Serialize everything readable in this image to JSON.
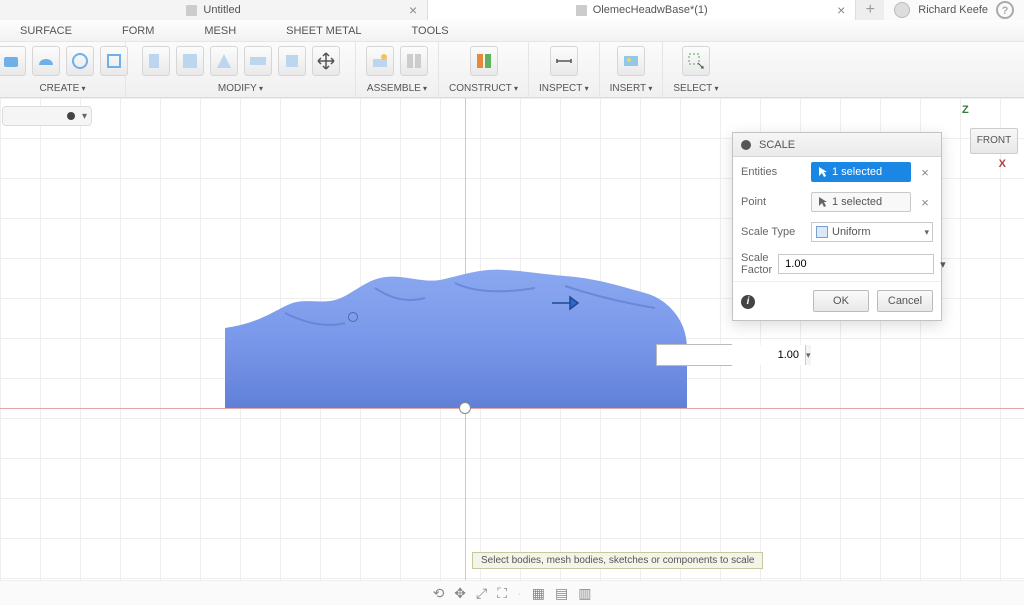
{
  "tabs": {
    "inactive": "Untitled",
    "active": "OlemecHeadwBase*(1)",
    "user": "Richard Keefe"
  },
  "menu": {
    "surface": "SURFACE",
    "form": "FORM",
    "mesh": "MESH",
    "sheetmetal": "SHEET METAL",
    "tools": "TOOLS"
  },
  "groups": {
    "create": "CREATE",
    "modify": "MODIFY",
    "assemble": "ASSEMBLE",
    "construct": "CONSTRUCT",
    "inspect": "INSPECT",
    "insert": "INSERT",
    "select": "SELECT"
  },
  "axis": {
    "z": "Z",
    "x": "X",
    "front": "FRONT"
  },
  "dialog": {
    "title": "SCALE",
    "entities_label": "Entities",
    "entities_value": "1 selected",
    "point_label": "Point",
    "point_value": "1 selected",
    "scaletype_label": "Scale Type",
    "scaletype_value": "Uniform",
    "scalefactor_label": "Scale Factor",
    "scalefactor_value": "1.00",
    "ok": "OK",
    "cancel": "Cancel"
  },
  "floatinput": "1.00",
  "hint": "Select bodies, mesh bodies, sketches or components to scale"
}
